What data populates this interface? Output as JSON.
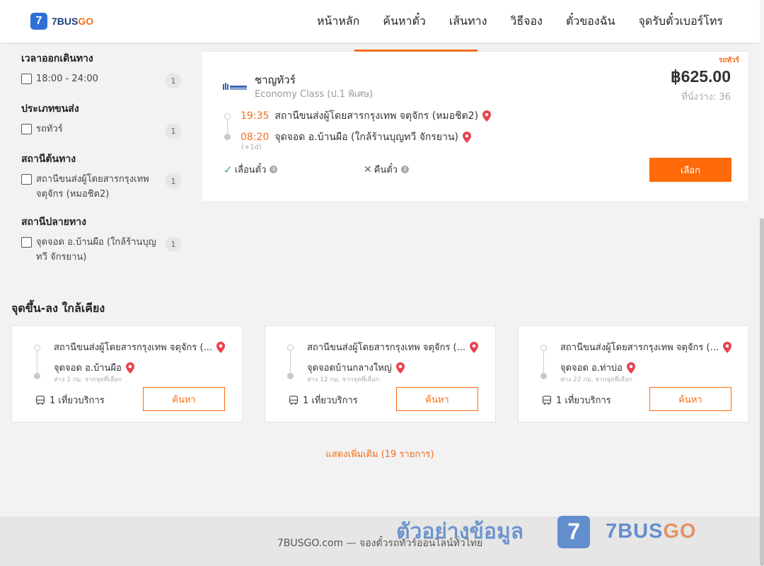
{
  "header": {
    "logo_badge": "7",
    "logo_text": "7BUS",
    "logo_text_accent": "GO",
    "nav": [
      "หน้าหลัก",
      "ค้นหาตั๋ว",
      "เส้นทาง",
      "วิธีจอง",
      "ตั๋วของฉัน",
      "จุดรับตั๋วเบอร์โทร"
    ]
  },
  "filters": {
    "departure_time": {
      "title": "เวลาออกเดินทาง",
      "options": [
        {
          "label": "18:00 - 24:00",
          "count": "1"
        }
      ]
    },
    "transport_type": {
      "title": "ประเภทขนส่ง",
      "options": [
        {
          "label": "รถทัวร์",
          "count": "1"
        }
      ]
    },
    "origin": {
      "title": "สถานีต้นทาง",
      "options": [
        {
          "label": "สถานีขนส่งผู้โดยสารกรุงเทพ จตุจักร (หมอชิต2)",
          "count": "1"
        }
      ]
    },
    "destination": {
      "title": "สถานีปลายทาง",
      "options": [
        {
          "label": "จุดจอด อ.บ้านผือ (ใกล้ร้านบุญทวี จักรยาน)",
          "count": "1"
        }
      ]
    }
  },
  "trip": {
    "tag": "รถทัวร์",
    "operator": "ชาญทัวร์",
    "bus_class": "Economy Class (ป.1 พิเศษ)",
    "price": "฿625.00",
    "seats": "ที่นั่งว่าง: 36",
    "depart_time": "19:35",
    "depart_station": "สถานีขนส่งผู้โดยสารกรุงเทพ จตุจักร (หมอชิต2)",
    "arrive_time": "08:20",
    "arrive_station": "จุดจอด อ.บ้านผือ (ใกล้ร้านบุญทวี จักรยาน)",
    "plus_day": "(+1d)",
    "policy_reschedule": "เลื่อนตั๋ว",
    "policy_refund": "คืนตั๋ว",
    "select_label": "เลือก"
  },
  "nearby": {
    "title": "จุดขึ้น-ลง ใกล้เคียง",
    "cards": [
      {
        "from": "สถานีขนส่งผู้โดยสารกรุงเทพ จตุจักร (...",
        "to": "จุดจอด อ.บ้านผือ",
        "distance": "ห่าง 1 กม. จากจุดที่เลือก",
        "trips": "1 เที่ยวบริการ",
        "button": "ค้นหา"
      },
      {
        "from": "สถานีขนส่งผู้โดยสารกรุงเทพ จตุจักร (...",
        "to": "จุดจอดบ้านกลางใหญ่",
        "distance": "ห่าง 12 กม. จากจุดที่เลือก",
        "trips": "1 เที่ยวบริการ",
        "button": "ค้นหา"
      },
      {
        "from": "สถานีขนส่งผู้โดยสารกรุงเทพ จตุจักร (...",
        "to": "จุดจอด อ.ท่าบ่อ",
        "distance": "ห่าง 22 กม. จากจุดที่เลือก",
        "trips": "1 เที่ยวบริการ",
        "button": "ค้นหา"
      }
    ],
    "show_more": "แสดงเพิ่มเติม (19 รายการ)"
  },
  "footer": {
    "text": "7BUSGO.com — จองตั๋วรถทัวร์ออนไลน์ทั่วไทย"
  },
  "watermark": {
    "text": "ตัวอย่างข้อมูล",
    "badge": "7",
    "brand": "7BUS",
    "brand_accent": "GO"
  },
  "colors": {
    "accent": "#ff6b0a",
    "brand_blue": "#2f6fd6"
  }
}
